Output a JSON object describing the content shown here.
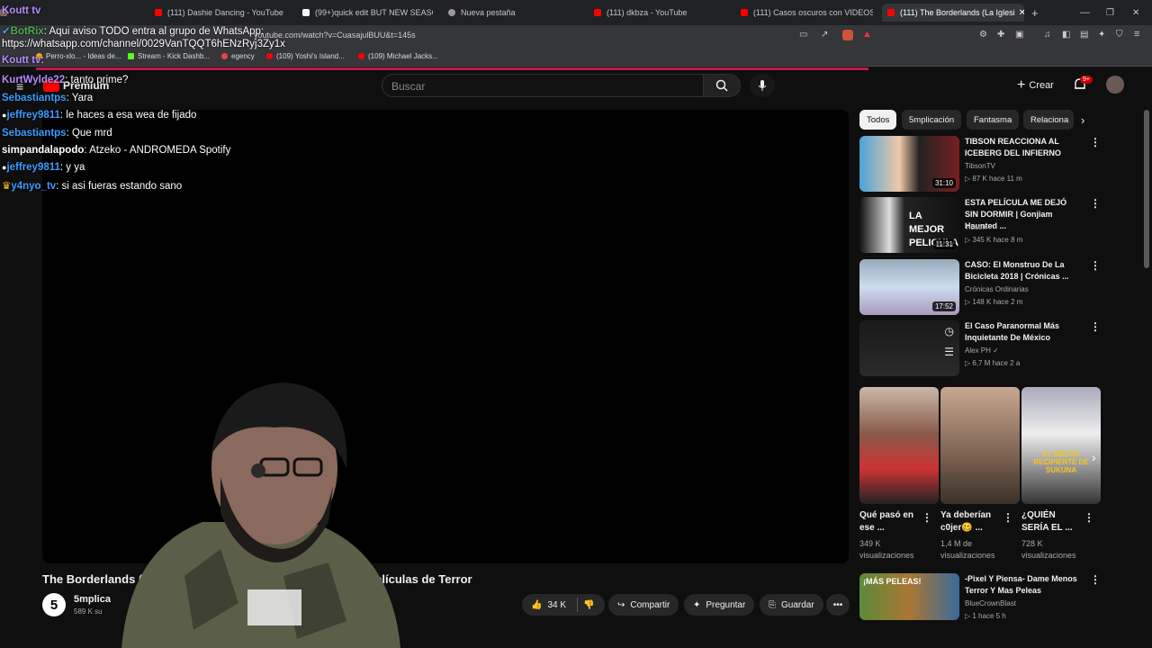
{
  "browser": {
    "tabs": [
      {
        "label": "",
        "active": false
      },
      {
        "label": "(111) Dashie Dancing - YouTube",
        "active": false
      },
      {
        "label": "(99+)quick edit BUT NEW SEASON",
        "active": false
      },
      {
        "label": "Nueva pestaña",
        "active": false
      },
      {
        "label": "(111) dkbza - YouTube",
        "active": false
      },
      {
        "label": "(111) Casos oscuros con VIDEOS HO",
        "active": false
      },
      {
        "label": "(111) The Borderlands (La Iglesi",
        "active": true
      }
    ],
    "url": "youtube.com/watch?v=CuasajulBUU&t=145s",
    "bookmarks": [
      "Perro-xlo... - Ideas de...",
      "Stream - Kick Dashb...",
      "egency",
      "(109) Yoshi's Island...",
      "(109) Michael Jacks..."
    ]
  },
  "youtube": {
    "premium_label": "Premium",
    "search_placeholder": "Buscar",
    "create_label": "Crear",
    "notif_badge": "9+"
  },
  "chat": [
    {
      "user": "Koutt tv",
      "msg": "",
      "color": "u-purple"
    },
    {
      "user": "BotRix",
      "msg": ": Aqui aviso TODO entra al grupo de WhatsApp:",
      "color": "u-green"
    },
    {
      "user": "",
      "msg": "https://whatsapp.com/channel/0029VanTQQT6hENzRyj3Zy1x",
      "color": "u-white"
    },
    {
      "user": "Koutt tv",
      "msg": ":",
      "color": "u-purple"
    },
    {
      "user": "KurtWylde22",
      "msg": ": tanto prime?",
      "color": "u-purple"
    },
    {
      "user": "Sebastiantps",
      "msg": ": Yara",
      "color": "u-blue"
    },
    {
      "user": "jeffrey9811",
      "msg": ": le haces   a esa wea de fijado",
      "color": "u-blue"
    },
    {
      "user": "Sebastiantps",
      "msg": ": Que mrd",
      "color": "u-blue"
    },
    {
      "user": "simpandalapodo",
      "msg": ": Atzeko - ANDROMEDA Spotify",
      "color": "u-white"
    },
    {
      "user": "jeffrey9811",
      "msg": ": y ya",
      "color": "u-blue"
    },
    {
      "user": "y4nyo_tv",
      "msg": ": si asi fueras estando sano",
      "color": "u-blue"
    }
  ],
  "video": {
    "title_left": "The Borderlands (",
    "title_right": "N | Películas de Terror",
    "channel_initial": "5",
    "channel": "5mplica",
    "subs": "589 K su",
    "likes": "34 K",
    "share": "Compartir",
    "ask": "Preguntar",
    "save": "Guardar"
  },
  "sidebar": {
    "chips": [
      "Todos",
      "5mplicación",
      "Fantasma",
      "Relaciona"
    ],
    "videos": [
      {
        "title": "TIBSON REACCIONA AL ICEBERG DEL INFIERNO",
        "channel": "TibsonTV",
        "meta": "▷ 87 K  hace 11 m",
        "duration": "31:10"
      },
      {
        "title": "ESTA PELÍCULA ME DEJÓ SIN DORMIR | Gonjiam Haunted ...",
        "channel": "Tibson ✓",
        "meta": "▷ 345 K  hace 8 m",
        "duration": "11:31"
      },
      {
        "title": "CASO: El Monstruo De La Bicicleta 2018 | Crónicas ...",
        "channel": "Crónicas Ordinarias",
        "meta": "▷ 148 K  hace 2 m",
        "duration": "17:52"
      },
      {
        "title": "El Caso Paranormal Más Inquietante De México",
        "channel": "Alex PH ✓",
        "meta": "▷ 6,7 M  hace 2 a",
        "duration": ""
      }
    ],
    "shorts": [
      {
        "title": "Qué pasó en ese ...",
        "views": "349 K visualizaciones"
      },
      {
        "title": "Ya deberían c0jer🥴 ...",
        "views": "1,4 M de visualizaciones"
      },
      {
        "title": "¿QUIÉN SERÍA EL ...",
        "views": "728 K visualizaciones"
      }
    ],
    "last_video": {
      "title": "-Pixel Y Piensa-  Dame Menos Terror Y Mas Peleas",
      "channel": "BlueCrownBlast",
      "meta": "▷ 1  hace 5 h"
    }
  },
  "thumb_texts": [
    "LA MEJOR PELICULA",
    "¡MÁS PELEAS!",
    "EL MEJOR RECIPIENTE DE SUKUNA"
  ]
}
